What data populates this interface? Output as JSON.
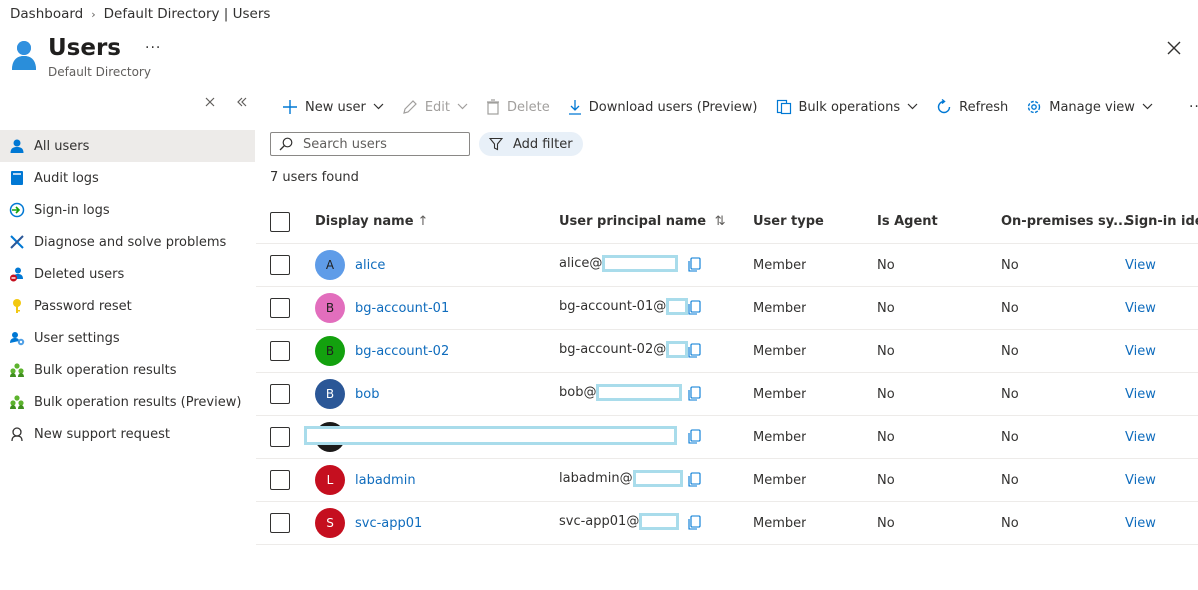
{
  "breadcrumb": {
    "home": "Dashboard",
    "current": "Default Directory | Users"
  },
  "header": {
    "title": "Users",
    "more": "···",
    "subtitle": "Default Directory"
  },
  "sidebar": {
    "items": [
      {
        "label": "All users",
        "icon": "user-icon"
      },
      {
        "label": "Audit logs",
        "icon": "book-icon"
      },
      {
        "label": "Sign-in logs",
        "icon": "sign-in-icon"
      },
      {
        "label": "Diagnose and solve problems",
        "icon": "wrench-icon"
      },
      {
        "label": "Deleted users",
        "icon": "deleted-user-icon"
      },
      {
        "label": "Password reset",
        "icon": "key-icon"
      },
      {
        "label": "User settings",
        "icon": "user-settings-icon"
      },
      {
        "label": "Bulk operation results",
        "icon": "group-icon"
      },
      {
        "label": "Bulk operation results (Preview)",
        "icon": "group-icon"
      },
      {
        "label": "New support request",
        "icon": "support-icon"
      }
    ]
  },
  "toolbar": {
    "new_user": "New user",
    "edit": "Edit",
    "delete": "Delete",
    "download": "Download users (Preview)",
    "bulk": "Bulk operations",
    "refresh": "Refresh",
    "manage_view": "Manage view",
    "more": "···"
  },
  "search": {
    "placeholder": "Search users"
  },
  "filter": {
    "label": "Add filter"
  },
  "results": {
    "count_text": "7 users found"
  },
  "table": {
    "headers": {
      "display_name": "Display name",
      "display_name_sort": "↑",
      "upn": "User principal name",
      "upn_sort": "⇅",
      "user_type": "User type",
      "is_agent": "Is Agent",
      "on_prem": "On-premises sy...",
      "signin": "Sign-in identi"
    },
    "rows": [
      {
        "initial": "A",
        "color": "#5f9ce8",
        "name": "alice",
        "upn": "alice@",
        "type": "Member",
        "agent": "No",
        "onprem": "No",
        "signin": "View"
      },
      {
        "initial": "B",
        "color": "#e26ebd",
        "name": "bg-account-01",
        "upn": "bg-account-01@",
        "type": "Member",
        "agent": "No",
        "onprem": "No",
        "signin": "View"
      },
      {
        "initial": "B",
        "color": "#13a10e",
        "name": "bg-account-02",
        "upn": "bg-account-02@",
        "type": "Member",
        "agent": "No",
        "onprem": "No",
        "signin": "View"
      },
      {
        "initial": "B",
        "color": "#2b5797",
        "name": "bob",
        "upn": "bob@",
        "type": "Member",
        "agent": "No",
        "onprem": "No",
        "signin": "View"
      },
      {
        "initial": "",
        "color": "#1b1a19",
        "name": "",
        "upn": "",
        "type": "Member",
        "agent": "No",
        "onprem": "No",
        "signin": "View"
      },
      {
        "initial": "L",
        "color": "#c50f1f",
        "name": "labadmin",
        "upn": "labadmin@",
        "type": "Member",
        "agent": "No",
        "onprem": "No",
        "signin": "View"
      },
      {
        "initial": "S",
        "color": "#c50f1f",
        "name": "svc-app01",
        "upn": "svc-app01@",
        "type": "Member",
        "agent": "No",
        "onprem": "No",
        "signin": "View"
      }
    ]
  }
}
